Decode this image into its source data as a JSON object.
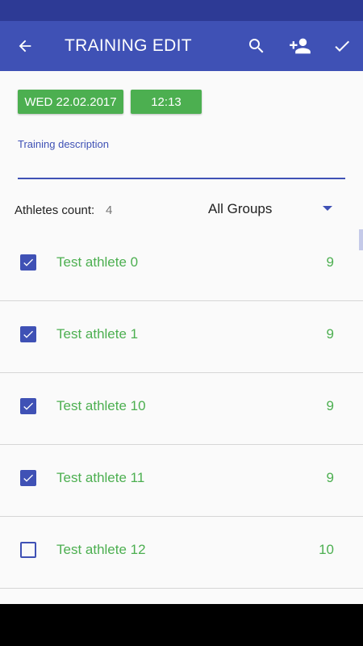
{
  "app_bar": {
    "title": "TRAINING EDIT",
    "back_icon": "arrow-back-icon",
    "actions": [
      "search-icon",
      "add-person-icon",
      "check-icon"
    ]
  },
  "training": {
    "date": "WED 22.02.2017",
    "time": "12:13",
    "description_label": "Training description",
    "description_value": ""
  },
  "athletes": {
    "count_label": "Athletes count:",
    "count": "4",
    "group_filter": "All Groups",
    "items": [
      {
        "name": "Test athlete 0",
        "score": "9",
        "checked": true
      },
      {
        "name": "Test athlete 1",
        "score": "9",
        "checked": true
      },
      {
        "name": "Test athlete 10",
        "score": "9",
        "checked": true
      },
      {
        "name": "Test athlete 11",
        "score": "9",
        "checked": true
      },
      {
        "name": "Test athlete 12",
        "score": "10",
        "checked": false
      }
    ]
  },
  "colors": {
    "primary": "#3f51b5",
    "status_bar": "#2d3a95",
    "accent_green": "#4caf50"
  }
}
